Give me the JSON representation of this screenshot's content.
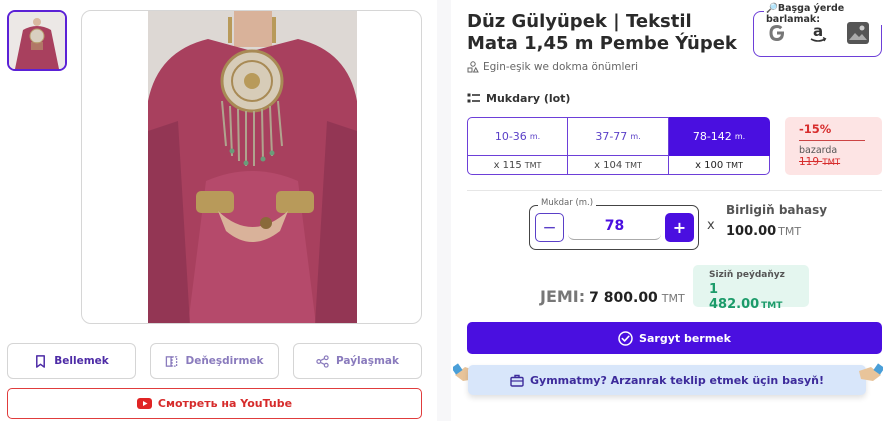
{
  "product": {
    "title": "Düz Gülyüpek | Tekstil Mata 1,45 m Pembe Ýüpek",
    "category": "Egin-eşik we dokma önümleri"
  },
  "actions": {
    "bookmark": "Bellemek",
    "compare": "Deňeşdirmek",
    "share": "Paýlaşmak",
    "youtube": "Смотреть на YouTube"
  },
  "elsewhere": {
    "label": "Başga ýerde barlamak:",
    "icons": [
      "google-icon",
      "amazon-icon",
      "image-search-icon"
    ]
  },
  "quantity": {
    "heading": "Mukdary (lot)",
    "tiers": [
      {
        "range": "10-36",
        "unit": "m.",
        "price": "x 115",
        "currency": "TMT",
        "selected": false
      },
      {
        "range": "37-77",
        "unit": "m.",
        "price": "x 104",
        "currency": "TMT",
        "selected": false
      },
      {
        "range": "78-142",
        "unit": "m.",
        "price": "x 100",
        "currency": "TMT",
        "selected": true
      }
    ],
    "discount": {
      "percent": "-15%",
      "market_label": "bazarda",
      "market_price": "119",
      "currency": "TMT"
    }
  },
  "stepper": {
    "legend": "Mukdar (m.)",
    "value": "78",
    "minus": "−",
    "plus": "+"
  },
  "unit_price": {
    "times": "x",
    "label": "Birligiň bahasy",
    "value": "100.00",
    "currency": "TMT"
  },
  "savings": {
    "label": "Siziň peýdaňyz",
    "value": "1 482.00",
    "currency": "TMT"
  },
  "total": {
    "label": "JEMI:",
    "value": "7 800.00",
    "currency": "TMT"
  },
  "order": {
    "label": "Sargyt bermek"
  },
  "offer": {
    "label": "Gymmatmy? Arzanrak teklip etmek üçin basyň!"
  },
  "colors": {
    "accent": "#4a0fe0",
    "discount_red": "#d72d2d",
    "savings_green": "#1c9b6a",
    "product_pink": "#a8405e"
  }
}
